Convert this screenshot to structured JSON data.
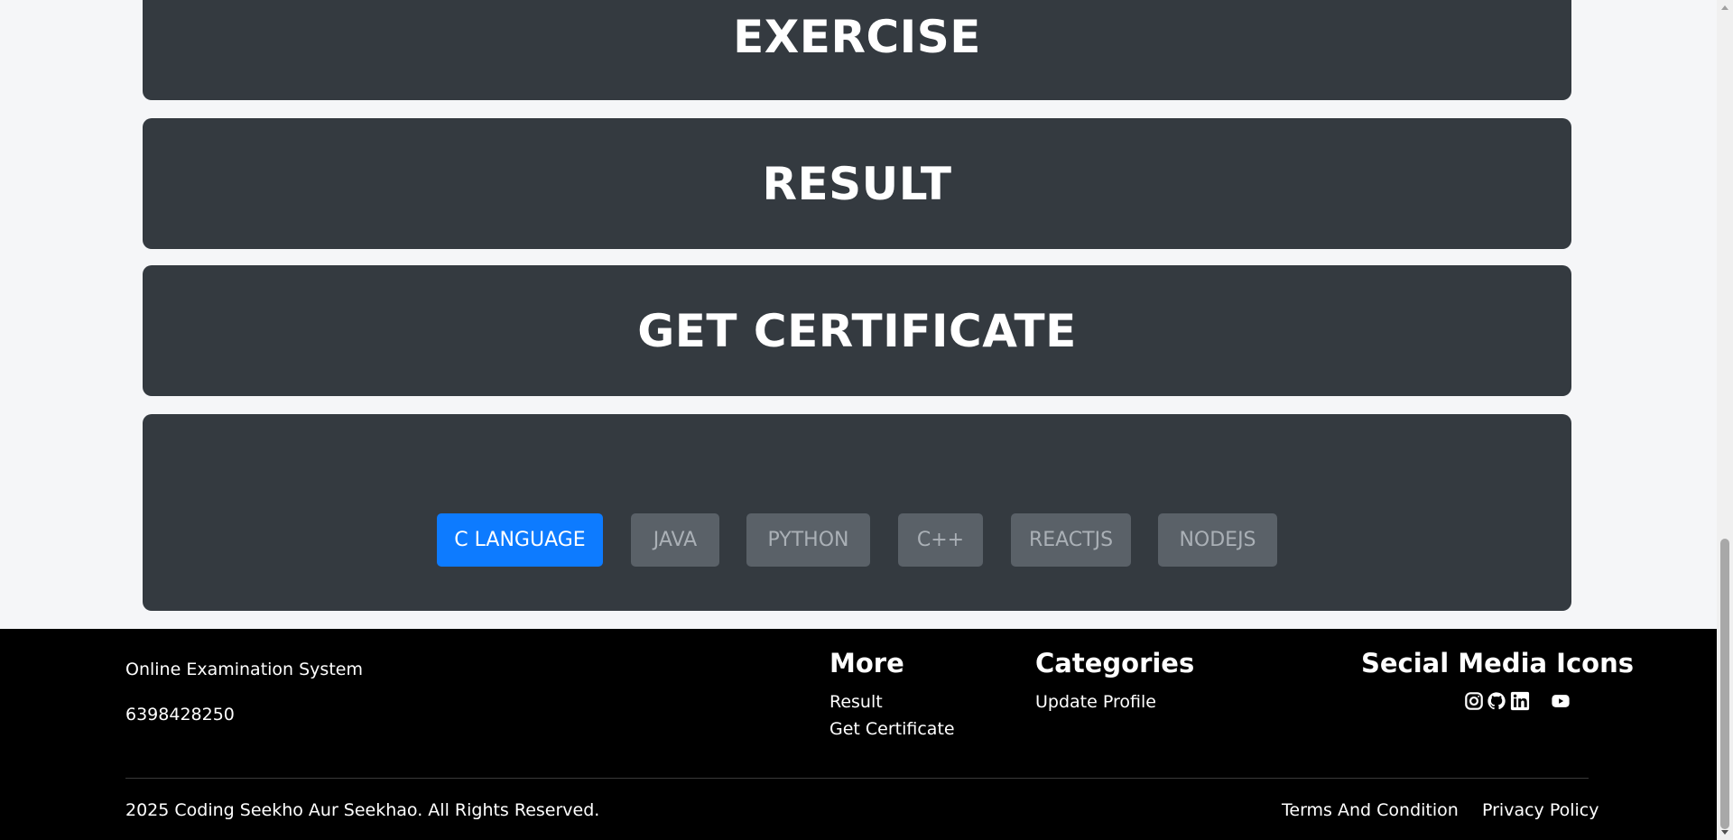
{
  "cards": {
    "exercise": "EXERCISE",
    "result": "RESULT",
    "certificate": "GET CERTIFICATE"
  },
  "languages": [
    {
      "label": "C LANGUAGE",
      "active": true
    },
    {
      "label": "JAVA",
      "active": false
    },
    {
      "label": "PYTHON",
      "active": false
    },
    {
      "label": "C++",
      "active": false
    },
    {
      "label": "REACTJS",
      "active": false
    },
    {
      "label": "NODEJS",
      "active": false
    }
  ],
  "footer": {
    "brand": "Online Examination System",
    "phone": "6398428250",
    "more": {
      "heading": "More",
      "links": [
        "Result",
        "Get Certificate"
      ]
    },
    "categories": {
      "heading": "Categories",
      "links": [
        "Update Profile"
      ]
    },
    "social": {
      "heading": "Secial Media Icons",
      "icons": [
        "instagram-icon",
        "github-icon",
        "linkedin-icon",
        "youtube-icon"
      ]
    },
    "copyright": "2025 Coding Seekho Aur Seekhao. All Rights Reserved.",
    "terms": "Terms And Condition",
    "privacy": "Privacy Policy"
  },
  "colors": {
    "card_bg": "#343a40",
    "active_tab": "#0d7bff",
    "inactive_tab": "#5a6168",
    "footer_bg": "#000000"
  }
}
